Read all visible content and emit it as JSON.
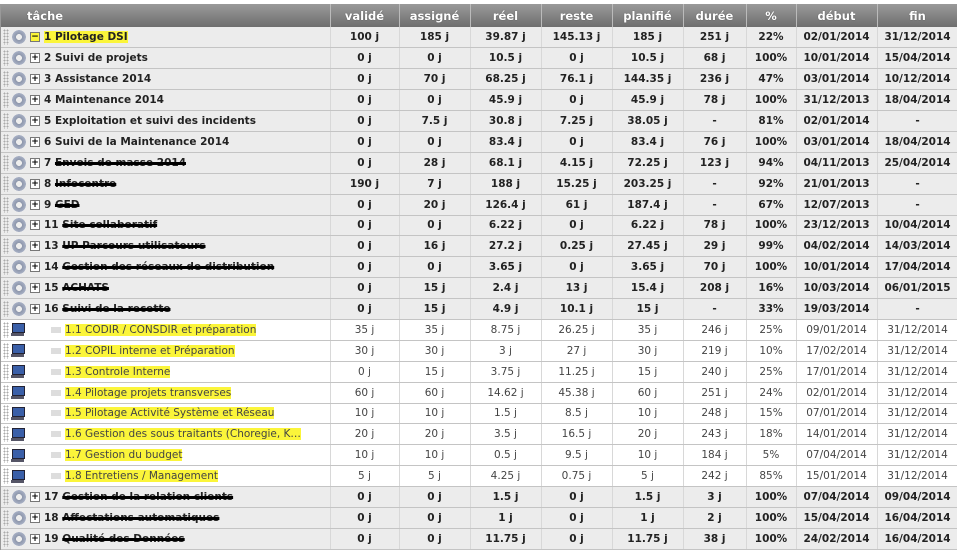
{
  "columns": [
    "tâche",
    "validé",
    "assigné",
    "réel",
    "reste",
    "planifié",
    "durée",
    "%",
    "début",
    "fin"
  ],
  "rows": [
    {
      "type": "parent",
      "toggle": "−",
      "label": "1 Pilotage DSI",
      "highlight": true,
      "values": [
        "100 j",
        "185 j",
        "39.87 j",
        "145.13 j",
        "185 j",
        "251 j",
        "22%",
        "02/01/2014",
        "31/12/2014"
      ]
    },
    {
      "type": "parent",
      "toggle": "+",
      "label": "2 Suivi de projets",
      "values": [
        "0 j",
        "0 j",
        "10.5 j",
        "0 j",
        "10.5 j",
        "68 j",
        "100%",
        "10/01/2014",
        "15/04/2014"
      ]
    },
    {
      "type": "parent",
      "toggle": "+",
      "label": "3 Assistance 2014",
      "values": [
        "0 j",
        "70 j",
        "68.25 j",
        "76.1 j",
        "144.35 j",
        "236 j",
        "47%",
        "03/01/2014",
        "10/12/2014"
      ]
    },
    {
      "type": "parent",
      "toggle": "+",
      "label": "4 Maintenance 2014",
      "values": [
        "0 j",
        "0 j",
        "45.9 j",
        "0 j",
        "45.9 j",
        "78 j",
        "100%",
        "31/12/2013",
        "18/04/2014"
      ]
    },
    {
      "type": "parent",
      "toggle": "+",
      "label": "5 Exploitation et suivi des incidents",
      "values": [
        "0 j",
        "7.5 j",
        "30.8 j",
        "7.25 j",
        "38.05 j",
        "-",
        "81%",
        "02/01/2014",
        "-"
      ]
    },
    {
      "type": "parent",
      "toggle": "+",
      "label": "6 Suivi de la Maintenance 2014",
      "values": [
        "0 j",
        "0 j",
        "83.4 j",
        "0 j",
        "83.4 j",
        "76 j",
        "100%",
        "03/01/2014",
        "18/04/2014"
      ]
    },
    {
      "type": "parent",
      "toggle": "+",
      "num": "7",
      "label": "Envois de masse 2014",
      "redacted": true,
      "values": [
        "0 j",
        "28 j",
        "68.1 j",
        "4.15 j",
        "72.25 j",
        "123 j",
        "94%",
        "04/11/2013",
        "25/04/2014"
      ]
    },
    {
      "type": "parent",
      "toggle": "+",
      "num": "8",
      "label": "Infocentre",
      "redacted": true,
      "values": [
        "190 j",
        "7 j",
        "188 j",
        "15.25 j",
        "203.25 j",
        "-",
        "92%",
        "21/01/2013",
        "-"
      ]
    },
    {
      "type": "parent",
      "toggle": "+",
      "num": "9",
      "label": "GED",
      "redacted": true,
      "values": [
        "0 j",
        "20 j",
        "126.4 j",
        "61 j",
        "187.4 j",
        "-",
        "67%",
        "12/07/2013",
        "-"
      ]
    },
    {
      "type": "parent",
      "toggle": "+",
      "num": "11",
      "label": "Site collaboratif",
      "redacted": true,
      "values": [
        "0 j",
        "0 j",
        "6.22 j",
        "0 j",
        "6.22 j",
        "78 j",
        "100%",
        "23/12/2013",
        "10/04/2014"
      ]
    },
    {
      "type": "parent",
      "toggle": "+",
      "num": "13",
      "label": "UP Parcours utilisateurs",
      "redacted": true,
      "values": [
        "0 j",
        "16 j",
        "27.2 j",
        "0.25 j",
        "27.45 j",
        "29 j",
        "99%",
        "04/02/2014",
        "14/03/2014"
      ]
    },
    {
      "type": "parent",
      "toggle": "+",
      "num": "14",
      "label": "Gestion des réseaux de distribution",
      "redacted": true,
      "values": [
        "0 j",
        "0 j",
        "3.65 j",
        "0 j",
        "3.65 j",
        "70 j",
        "100%",
        "10/01/2014",
        "17/04/2014"
      ]
    },
    {
      "type": "parent",
      "toggle": "+",
      "num": "15",
      "label": "ACHATS",
      "redacted": true,
      "values": [
        "0 j",
        "15 j",
        "2.4 j",
        "13 j",
        "15.4 j",
        "208 j",
        "16%",
        "10/03/2014",
        "06/01/2015"
      ]
    },
    {
      "type": "parent",
      "toggle": "+",
      "num": "16",
      "label": "Suivi de la recette",
      "redacted": true,
      "values": [
        "0 j",
        "15 j",
        "4.9 j",
        "10.1 j",
        "15 j",
        "-",
        "33%",
        "19/03/2014",
        "-"
      ]
    },
    {
      "type": "child",
      "label": "1.1 CODIR / CONSDIR et préparation",
      "values": [
        "35 j",
        "35 j",
        "8.75 j",
        "26.25 j",
        "35 j",
        "246 j",
        "25%",
        "09/01/2014",
        "31/12/2014"
      ]
    },
    {
      "type": "child",
      "label": "1.2 COPIL interne et Préparation",
      "values": [
        "30 j",
        "30 j",
        "3 j",
        "27 j",
        "30 j",
        "219 j",
        "10%",
        "17/02/2014",
        "31/12/2014"
      ]
    },
    {
      "type": "child",
      "label": "1.3 Controle Interne",
      "values": [
        "0 j",
        "15 j",
        "3.75 j",
        "11.25 j",
        "15 j",
        "240 j",
        "25%",
        "17/01/2014",
        "31/12/2014"
      ]
    },
    {
      "type": "child",
      "label": "1.4 Pilotage projets transverses",
      "values": [
        "60 j",
        "60 j",
        "14.62 j",
        "45.38 j",
        "60 j",
        "251 j",
        "24%",
        "02/01/2014",
        "31/12/2014"
      ]
    },
    {
      "type": "child",
      "label": "1.5 Pilotage Activité Système et Réseau",
      "values": [
        "10 j",
        "10 j",
        "1.5 j",
        "8.5 j",
        "10 j",
        "248 j",
        "15%",
        "07/01/2014",
        "31/12/2014"
      ]
    },
    {
      "type": "child",
      "label": "1.6 Gestion des sous traitants (Choregie, K…",
      "values": [
        "20 j",
        "20 j",
        "3.5 j",
        "16.5 j",
        "20 j",
        "243 j",
        "18%",
        "14/01/2014",
        "31/12/2014"
      ]
    },
    {
      "type": "child",
      "label": "1.7 Gestion du budget",
      "values": [
        "10 j",
        "10 j",
        "0.5 j",
        "9.5 j",
        "10 j",
        "184 j",
        "5%",
        "07/04/2014",
        "31/12/2014"
      ]
    },
    {
      "type": "child",
      "label": "1.8 Entretiens / Management",
      "values": [
        "5 j",
        "5 j",
        "4.25 j",
        "0.75 j",
        "5 j",
        "242 j",
        "85%",
        "15/01/2014",
        "31/12/2014"
      ]
    },
    {
      "type": "parent",
      "toggle": "+",
      "num": "17",
      "label": "Gestion de la relation clients",
      "redacted": true,
      "values": [
        "0 j",
        "0 j",
        "1.5 j",
        "0 j",
        "1.5 j",
        "3 j",
        "100%",
        "07/04/2014",
        "09/04/2014"
      ]
    },
    {
      "type": "parent",
      "toggle": "+",
      "num": "18",
      "label": "Affectations automatiques",
      "redacted": true,
      "values": [
        "0 j",
        "0 j",
        "1 j",
        "0 j",
        "1 j",
        "2 j",
        "100%",
        "15/04/2014",
        "16/04/2014"
      ]
    },
    {
      "type": "parent",
      "toggle": "+",
      "num": "19",
      "label": "Qualité des Données",
      "redacted": true,
      "values": [
        "0 j",
        "0 j",
        "11.75 j",
        "0 j",
        "11.75 j",
        "38 j",
        "100%",
        "24/02/2014",
        "16/04/2014"
      ]
    }
  ],
  "colors": {
    "highlight": "#fbf53a",
    "header": "#7a7a7a",
    "parent_row": "#ececec"
  }
}
